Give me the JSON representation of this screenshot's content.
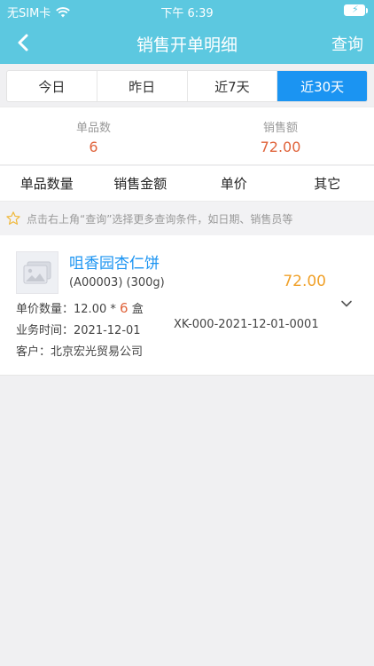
{
  "status": {
    "carrier": "无SIM卡",
    "time": "下午 6:39"
  },
  "nav": {
    "title": "销售开单明细",
    "action": "查询"
  },
  "tabs": [
    {
      "label": "今日",
      "active": false
    },
    {
      "label": "昨日",
      "active": false
    },
    {
      "label": "近7天",
      "active": false
    },
    {
      "label": "近30天",
      "active": true
    }
  ],
  "summary": {
    "count_label": "单品数",
    "count_value": "6",
    "amount_label": "销售额",
    "amount_value": "72.00"
  },
  "sort": [
    "单品数量",
    "销售金额",
    "单价",
    "其它"
  ],
  "hint": "点击右上角“查询”选择更多查询条件，如日期、销售员等",
  "record": {
    "name": "咀香园杏仁饼",
    "code": "(A00003) (300g)",
    "amount": "72.00",
    "unit_qty_label": "单价数量：",
    "unit_price": "12.00",
    "times": "*",
    "qty": "6",
    "unit": "盒",
    "biz_time_label": "业务时间：",
    "biz_time": "2021-12-01",
    "doc_no": "XK-000-2021-12-01-0001",
    "customer_label": "客户：",
    "customer": "北京宏光贸易公司"
  },
  "colors": {
    "header": "#5cc8e0",
    "active_tab": "#1b94f2",
    "accent_red": "#e0643c",
    "accent_orange": "#f0a12a"
  }
}
